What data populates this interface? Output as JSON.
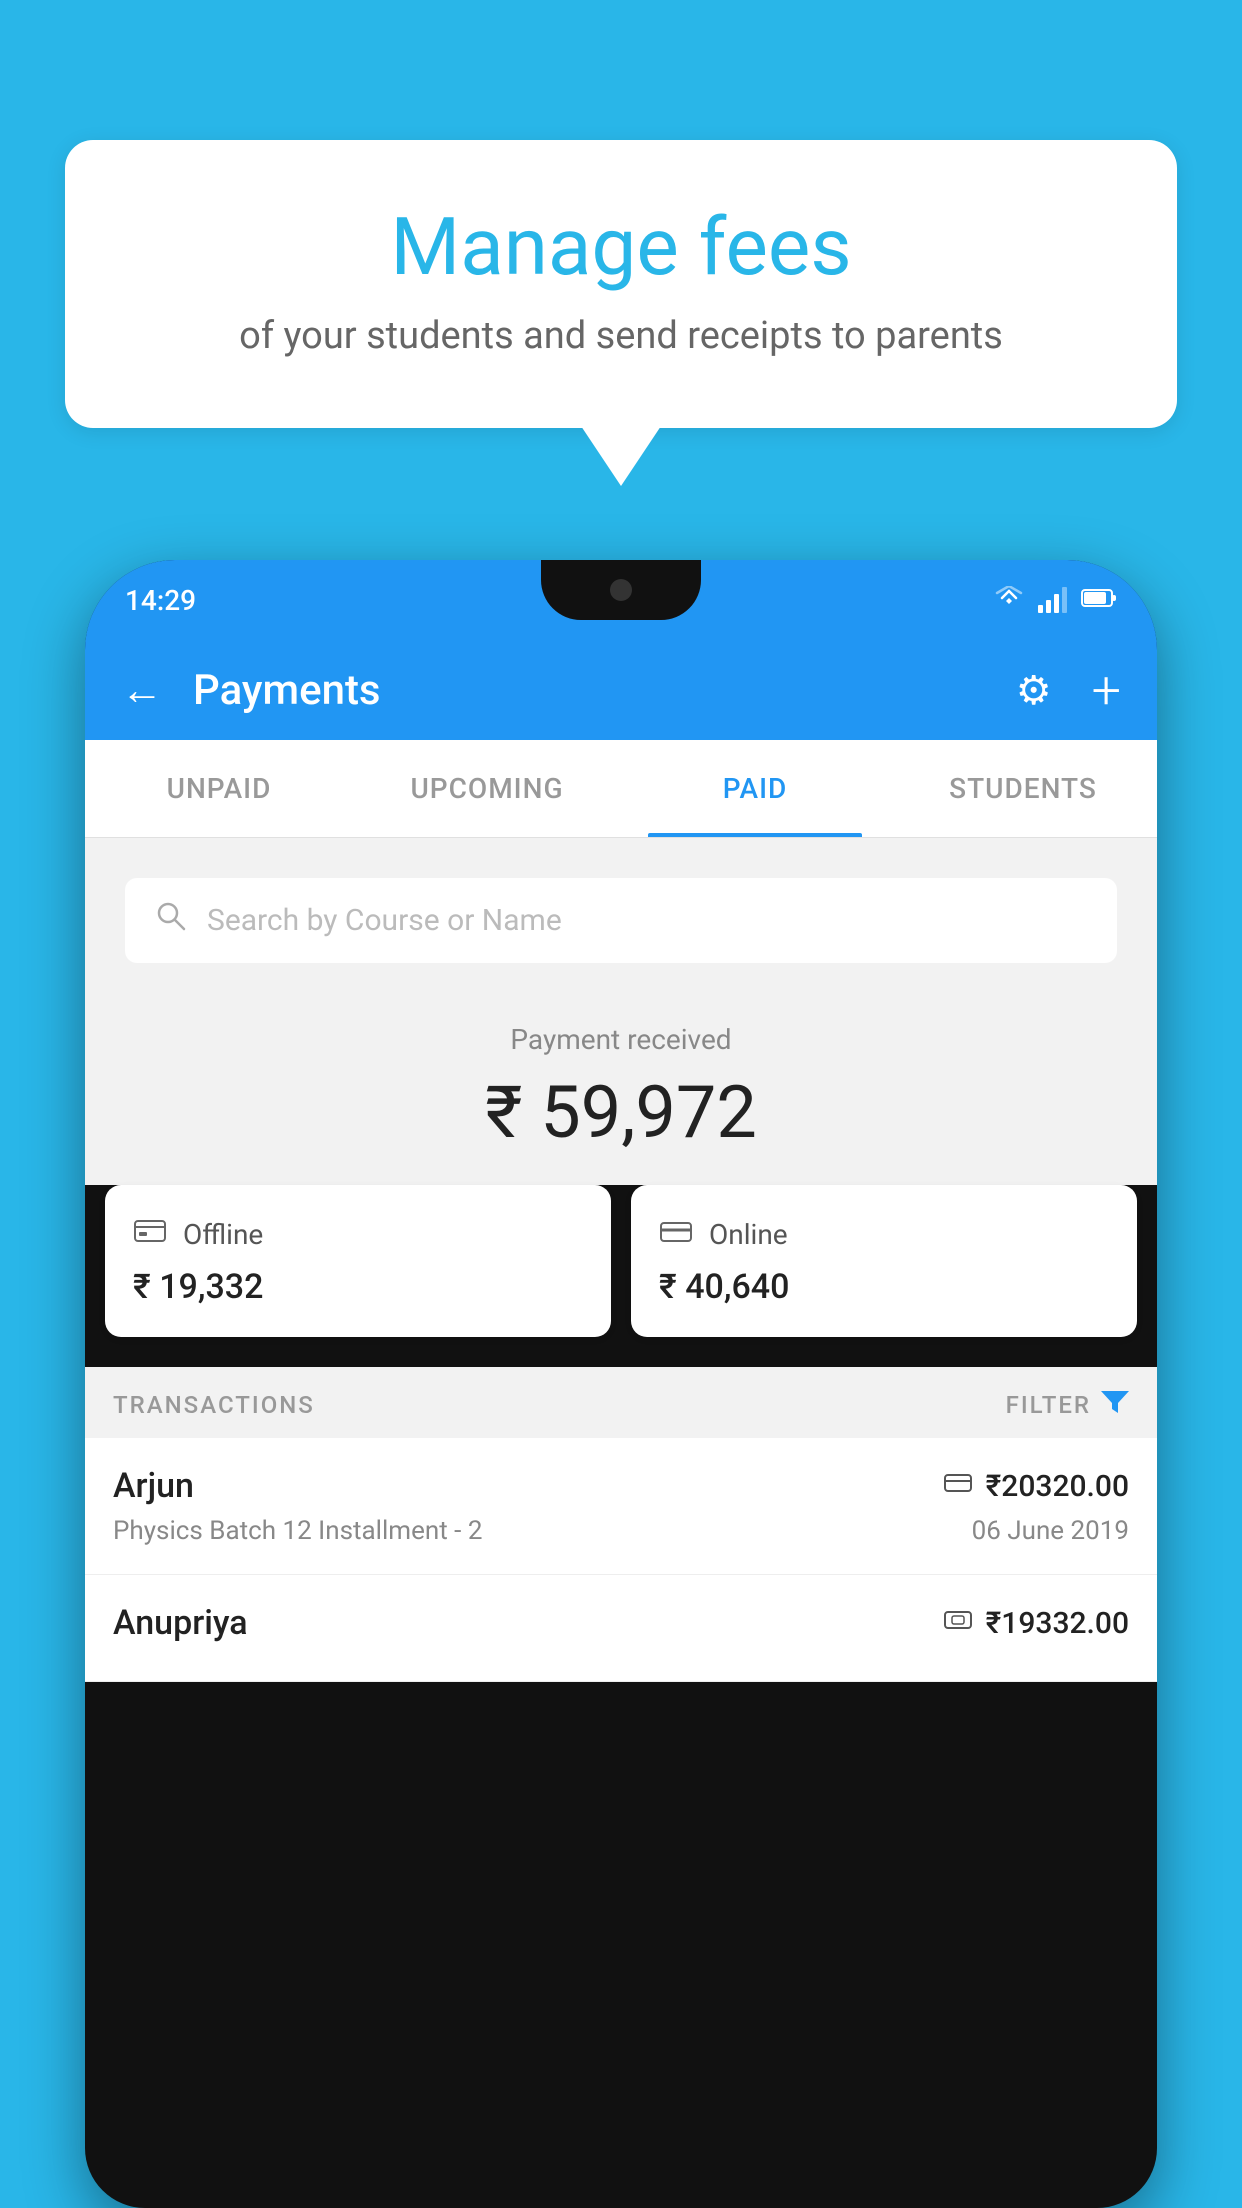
{
  "background_color": "#29b6e8",
  "speech_bubble": {
    "title": "Manage fees",
    "subtitle": "of your students and send receipts to parents"
  },
  "phone": {
    "status_bar": {
      "time": "14:29",
      "wifi_icon": "wifi",
      "signal_icon": "signal",
      "battery_icon": "battery"
    },
    "header": {
      "back_label": "←",
      "title": "Payments",
      "gear_icon": "⚙",
      "plus_icon": "+"
    },
    "tabs": [
      {
        "label": "UNPAID",
        "active": false
      },
      {
        "label": "UPCOMING",
        "active": false
      },
      {
        "label": "PAID",
        "active": true
      },
      {
        "label": "STUDENTS",
        "active": false
      }
    ],
    "search": {
      "placeholder": "Search by Course or Name"
    },
    "payment_summary": {
      "received_label": "Payment received",
      "total_amount": "₹ 59,972",
      "offline": {
        "label": "Offline",
        "amount": "₹ 19,332"
      },
      "online": {
        "label": "Online",
        "amount": "₹ 40,640"
      }
    },
    "transactions_section": {
      "label": "TRANSACTIONS",
      "filter_label": "FILTER"
    },
    "transactions": [
      {
        "name": "Arjun",
        "amount": "₹20320.00",
        "payment_type_icon": "card",
        "course": "Physics Batch 12 Installment - 2",
        "date": "06 June 2019"
      },
      {
        "name": "Anupriya",
        "amount": "₹19332.00",
        "payment_type_icon": "cash",
        "course": "",
        "date": ""
      }
    ]
  }
}
